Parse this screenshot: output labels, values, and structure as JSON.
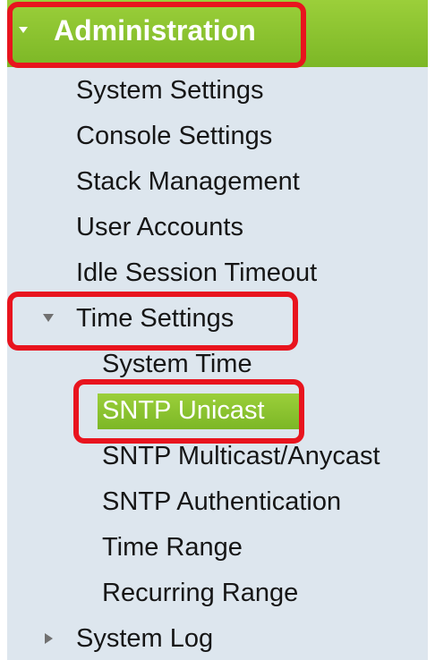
{
  "nav": {
    "header": {
      "label": "Administration",
      "icon": "triangle-down-icon"
    },
    "items": [
      {
        "label": "System Settings"
      },
      {
        "label": "Console Settings"
      },
      {
        "label": "Stack Management"
      },
      {
        "label": "User Accounts"
      },
      {
        "label": "Idle Session Timeout"
      }
    ],
    "time_settings": {
      "label": "Time Settings",
      "icon": "triangle-down-icon",
      "children": [
        {
          "label": "System Time"
        },
        {
          "label": "SNTP Unicast",
          "selected": true
        },
        {
          "label": "SNTP Multicast/Anycast"
        },
        {
          "label": "SNTP Authentication"
        },
        {
          "label": "Time Range"
        },
        {
          "label": "Recurring Range"
        }
      ]
    },
    "system_log": {
      "label": "System Log",
      "icon": "triangle-right-icon"
    }
  },
  "colors": {
    "accent_green": "#8cc530",
    "panel_bg": "#dde6ee",
    "highlight_red": "#e8141e",
    "text": "#161616"
  }
}
